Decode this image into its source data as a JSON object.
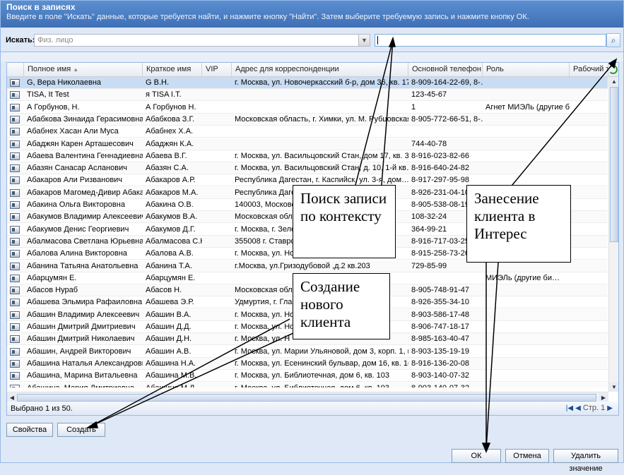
{
  "window": {
    "title": "Поиск в записях",
    "subtitle": "Введите в поле \"Искать\" данные, которые требуется найти, и нажмите кнопку \"Найти\". Затем выберите требуемую запись и нажмите кнопку ОК."
  },
  "search": {
    "label": "Искать:",
    "combo_value": "Физ. лицо",
    "input_value": ""
  },
  "grid": {
    "columns": [
      "Полное имя",
      "Краткое имя",
      "VIP",
      "Адрес для корреспонденции",
      "Основной телефон (…",
      "Роль",
      "Рабочий тел"
    ],
    "rows": [
      {
        "name": "G, Вера Николаевна",
        "short": "G В.Н.",
        "vip": "",
        "address": "г. Москва, ул. Новочеркасский б-р, дом 36, кв. 17",
        "phone": "8-909-164-22-69, 8-…",
        "role": ""
      },
      {
        "name": "TISA, It Test",
        "short": "я TISA I.T.",
        "vip": "",
        "address": "",
        "phone": "123-45-67",
        "role": ""
      },
      {
        "name": "А Горбунов, Н.",
        "short": "А Горбунов Н.",
        "vip": "",
        "address": "",
        "phone": "1",
        "role": "Агнет МИЭЛь (другие би…"
      },
      {
        "name": "Абабкова Зинаида Герасимовна",
        "short": "Абабкова З.Г.",
        "vip": "",
        "address": "Московская область, г. Химки, ул. М. Рубцовская, дом 7…",
        "phone": "8-905-772-66-51, 8-…",
        "role": ""
      },
      {
        "name": "Абабнех Хасан Али Муса",
        "short": "Абабнех Х.А.",
        "vip": "",
        "address": "",
        "phone": "",
        "role": ""
      },
      {
        "name": "Абаджян Карен Арташесович",
        "short": "Абаджян К.А.",
        "vip": "",
        "address": "",
        "phone": "744-40-78",
        "role": ""
      },
      {
        "name": "Абаева Валентина Геннадиевна",
        "short": "Абаева В.Г.",
        "vip": "",
        "address": "г. Москва, ул. Васильцовский Стан, дом 17, кв. 35",
        "phone": "8-916-023-82-66",
        "role": ""
      },
      {
        "name": "Абазян Санасар Асланович",
        "short": "Абазян С.А.",
        "vip": "",
        "address": "г. Москва, ул. Васильцовский Стан, д. 10, 1-й кв…",
        "phone": "8-916-640-24-82",
        "role": ""
      },
      {
        "name": "Абакаров Али Ризванович",
        "short": "Абакаров А.Р.",
        "vip": "",
        "address": "Республика Дагестан, г. Каспийск, ул. 3-я, дом…",
        "phone": "8-917-297-95-98",
        "role": ""
      },
      {
        "name": "Абакаров Магомед-Дивир Абакар…",
        "short": "Абакаров М.А.",
        "vip": "",
        "address": "Республика Дагестан",
        "phone": "8-926-231-04-10",
        "role": ""
      },
      {
        "name": "Абакина Ольга Викторовна",
        "short": "Абакина О.В.",
        "vip": "",
        "address": "140003, Московская",
        "phone": "8-905-538-08-19 А",
        "role": ""
      },
      {
        "name": "Абакумов Владимир Алексеевич",
        "short": "Абакумов В.А.",
        "vip": "",
        "address": "Московская област",
        "phone": "108-32-24",
        "role": ""
      },
      {
        "name": "Абакумов Денис Георгиевич",
        "short": "Абакумов Д.Г.",
        "vip": "",
        "address": "г. Москва, г. Зелен",
        "phone": "364-99-21",
        "role": ""
      },
      {
        "name": "Абалмасова Светлана Юрьевна",
        "short": "Абалмасова С.Ю.",
        "vip": "",
        "address": "355008 г. Ставропо",
        "phone": "8-916-717-03-25",
        "role": ""
      },
      {
        "name": "Абалова Алина Викторовна",
        "short": "Абалова А.В.",
        "vip": "",
        "address": "г. Москва, ул. Ново",
        "phone": "8-915-258-73-26, 8",
        "role": ""
      },
      {
        "name": "Абанина Татьяна Анатольевна",
        "short": "Абанина Т.А.",
        "vip": "",
        "address": "г.Москва, ул.Гризодубовой ,д.2 кв.203",
        "phone": "729-85-99",
        "role": ""
      },
      {
        "name": "Абарцумян Е.",
        "short": "Абарцумян Е.",
        "vip": "",
        "address": "",
        "phone": "",
        "role": "МИЭЛь (другие би…"
      },
      {
        "name": "Абасов Нураб",
        "short": "Абасов Н.",
        "vip": "",
        "address": "Московская област",
        "phone": "8-905-748-91-47",
        "role": ""
      },
      {
        "name": "Абашева Эльмира Рафаиловна",
        "short": "Абашева Э.Р.",
        "vip": "",
        "address": "Удмуртия, г. Глазо",
        "phone": "8-926-355-34-10",
        "role": ""
      },
      {
        "name": "Абашин Владимир Алексеевич",
        "short": "Абашин В.А.",
        "vip": "",
        "address": "г. Москва, ул. Ново",
        "phone": "8-903-586-17-48",
        "role": ""
      },
      {
        "name": "Абашин Дмитрий Дмитриевич",
        "short": "Абашин Д.Д.",
        "vip": "",
        "address": "г. Москва, ул. Нов",
        "phone": "8-906-747-18-17",
        "role": ""
      },
      {
        "name": "Абашин Дмитрий Николаевич",
        "short": "Абашин Д.Н.",
        "vip": "",
        "address": "г. Москва, ул. Н",
        "phone": "8-985-163-40-47",
        "role": ""
      },
      {
        "name": "Абашин, Андрей Викторович",
        "short": "Абашин А.В.",
        "vip": "",
        "address": "г. Москва, ул. Марии Ульяновой, дом 3, корп. 1, кв. 101",
        "phone": "8-903-135-19-19",
        "role": ""
      },
      {
        "name": "Абашина Наталья Александровна",
        "short": "Абашина Н.А.",
        "vip": "",
        "address": "г. Москва, ул. Есенинский бульвар, дом 16, кв. 167",
        "phone": "8-916-136-20-08",
        "role": ""
      },
      {
        "name": "Абашина, Марина Витальевна",
        "short": "Абашина М.В.",
        "vip": "",
        "address": "г. Москва, ул. Библиотечная, дом 6, кв. 103",
        "phone": "8-903-140-07-32",
        "role": ""
      },
      {
        "name": "Абашина, Мария Дмитриевна",
        "short": "Абашина М.Д.",
        "vip": "",
        "address": "г. Москва, ул. Библиотечная, дом 6, кв. 103",
        "phone": "8-903-140-07-32",
        "role": ""
      }
    ]
  },
  "status": {
    "selected": "Выбрано 1 из 50.",
    "page_label": "Стр. 1"
  },
  "buttons": {
    "properties": "Свойства",
    "create": "Создать",
    "ok": "ОК",
    "cancel": "Отмена",
    "delete_value": "Удалить значение"
  },
  "callouts": {
    "context_search": "Поиск записи по контексту",
    "new_client": "Создание нового клиента",
    "to_interes": "Занесение клиента в Интерес"
  },
  "icons": {
    "search": "magnifier-icon",
    "refresh": "refresh-icon",
    "row": "client-card-icon"
  }
}
